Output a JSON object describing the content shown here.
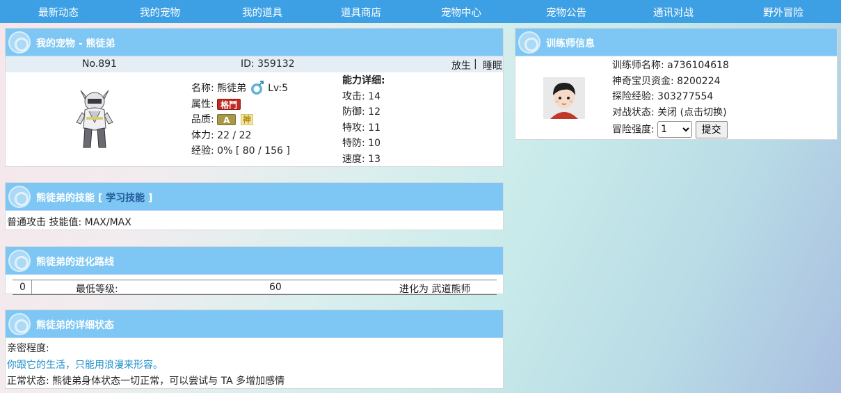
{
  "nav": [
    {
      "label": "最新动态"
    },
    {
      "label": "我的宠物"
    },
    {
      "label": "我的道具"
    },
    {
      "label": "道具商店"
    },
    {
      "label": "宠物中心"
    },
    {
      "label": "宠物公告"
    },
    {
      "label": "通讯对战"
    },
    {
      "label": "野外冒险"
    }
  ],
  "pet": {
    "panel_title": "我的宠物 - 熊徒弟",
    "no": "No.891",
    "id": "ID: 359132",
    "release_label": "放生",
    "separator": "|",
    "sleep_label": "睡眠",
    "name_label": "名称:",
    "name": "熊徒弟",
    "level": "Lv:5",
    "type_label": "属性:",
    "type_badge": "格鬥",
    "quality_label": "品质:",
    "quality_badge": "A",
    "quality_extra": "神",
    "hp": "体力: 22 / 22",
    "exp": "经验: 0% [ 80 / 156 ]",
    "ability_header": "能力详细:",
    "abilities": [
      "攻击: 14",
      "防御: 12",
      "特攻: 11",
      "特防: 10",
      "速度: 13"
    ]
  },
  "skills": {
    "title_prefix": "熊徒弟的技能",
    "bracket_open": "[",
    "learn_label": "学习技能",
    "bracket_close": "]",
    "skill_text": "普通攻击 技能值: MAX/MAX"
  },
  "evolution": {
    "title": "熊徒弟的进化路线",
    "index": "0",
    "min_level_label": "最低等级:",
    "min_level": "60",
    "evolve_to": "进化为 武道熊师"
  },
  "status": {
    "title": "熊徒弟的详细状态",
    "intimacy_label": "亲密程度:",
    "intimacy_text": "你跟它的生活，只能用浪漫来形容。",
    "normal_status": "正常状态: 熊徒弟身体状态一切正常，可以尝试与 TA 多增加感情"
  },
  "trainer": {
    "title": "训练师信息",
    "name": "训练师名称: a736104618",
    "funds": "神奇宝贝资金: 8200224",
    "exp": "探险经验: 303277554",
    "battle_label": "对战状态:",
    "battle_state": "关闭",
    "battle_toggle": "(点击切换)",
    "difficulty_label": "冒险强度:",
    "difficulty_value": "1",
    "submit_label": "提交"
  },
  "colors": {
    "nav_bg": "#3ea0e4",
    "panel_head": "#7ec6f3",
    "fight_badge": "#c02a22",
    "intimacy_text": "#1d8ec8"
  }
}
